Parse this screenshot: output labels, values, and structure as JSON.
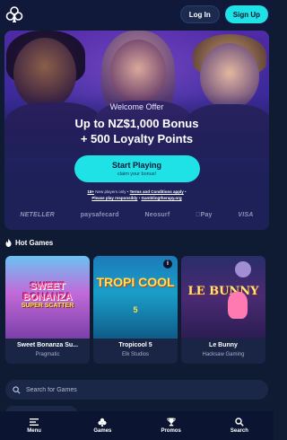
{
  "header": {
    "login_label": "Log In",
    "signup_label": "Sign Up"
  },
  "hero": {
    "welcome": "Welcome Offer",
    "offer_line1": "Up to NZ$1,000 Bonus",
    "offer_line2": "+ 500 Loyalty Points",
    "cta_label": "Start Playing",
    "cta_sublabel": "claim your bonus!",
    "legal_line1_a": "18+",
    "legal_line1_b": " New players only • ",
    "legal_line1_c": "Terms and Conditions apply",
    "legal_line1_d": " •",
    "legal_line2_a": "Please play responsibly",
    "legal_line2_b": " • ",
    "legal_line2_c": "Gamblingtherapy.org"
  },
  "payments": [
    "NETELLER",
    "paysafecard",
    "Neosurf",
    "Pay",
    "VISA"
  ],
  "hot_games": {
    "title": "Hot Games",
    "games": [
      {
        "name": "Sweet Bonanza Su...",
        "provider": "Pragmatic",
        "art_line1": "SWEET BONANZA",
        "art_line2": "SUPER SCATTER"
      },
      {
        "name": "Tropicool 5",
        "provider": "Elk Studios",
        "art_line1": "TROPI COOL",
        "art_line2": "5"
      },
      {
        "name": "Le Bunny",
        "provider": "Hacksaw Gaming",
        "art_line1": "LE BUNNY"
      }
    ]
  },
  "search": {
    "placeholder": "Search for Games"
  },
  "bottom_nav": [
    {
      "label": "Menu",
      "icon": "hamburger-icon"
    },
    {
      "label": "Games",
      "icon": "club-icon"
    },
    {
      "label": "Promos",
      "icon": "trophy-icon"
    },
    {
      "label": "Search",
      "icon": "search-icon"
    }
  ],
  "colors": {
    "accent": "#1ee2e6",
    "background": "#0f1a33"
  }
}
